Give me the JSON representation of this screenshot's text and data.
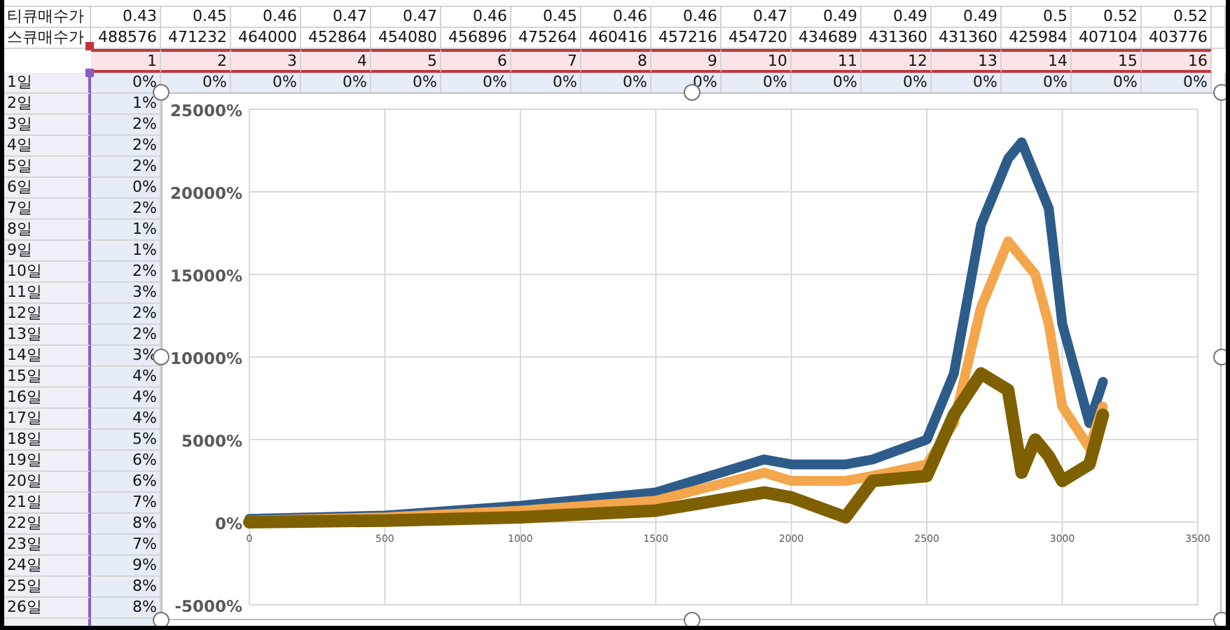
{
  "top_rows": [
    {
      "label": "티큐매수가",
      "cells": [
        "0.43",
        "0.45",
        "0.46",
        "0.47",
        "0.47",
        "0.46",
        "0.45",
        "0.46",
        "0.46",
        "0.47",
        "0.49",
        "0.49",
        "0.49",
        "0.5",
        "0.52",
        "0.52"
      ]
    },
    {
      "label": "스큐매수가",
      "cells": [
        "488576",
        "471232",
        "464000",
        "452864",
        "454080",
        "456896",
        "475264",
        "460416",
        "457216",
        "454720",
        "434689",
        "431360",
        "431360",
        "425984",
        "407104",
        "403776"
      ]
    }
  ],
  "header_numbers": [
    "1",
    "2",
    "3",
    "4",
    "5",
    "6",
    "7",
    "8",
    "9",
    "10",
    "11",
    "12",
    "13",
    "14",
    "15",
    "16"
  ],
  "first_day": {
    "label": "1일",
    "cells": [
      "0%",
      "0%",
      "0%",
      "0%",
      "0%",
      "0%",
      "0%",
      "0%",
      "0%",
      "0%",
      "0%",
      "0%",
      "0%",
      "0%",
      "0%",
      "0%"
    ]
  },
  "days": [
    {
      "label": "2일",
      "value": "1%"
    },
    {
      "label": "3일",
      "value": "2%"
    },
    {
      "label": "4일",
      "value": "2%"
    },
    {
      "label": "5일",
      "value": "2%"
    },
    {
      "label": "6일",
      "value": "0%"
    },
    {
      "label": "7일",
      "value": "2%"
    },
    {
      "label": "8일",
      "value": "1%"
    },
    {
      "label": "9일",
      "value": "1%"
    },
    {
      "label": "10일",
      "value": "2%"
    },
    {
      "label": "11일",
      "value": "3%"
    },
    {
      "label": "12일",
      "value": "2%"
    },
    {
      "label": "13일",
      "value": "2%"
    },
    {
      "label": "14일",
      "value": "3%"
    },
    {
      "label": "15일",
      "value": "4%"
    },
    {
      "label": "16일",
      "value": "4%"
    },
    {
      "label": "17일",
      "value": "4%"
    },
    {
      "label": "18일",
      "value": "5%"
    },
    {
      "label": "19일",
      "value": "6%"
    },
    {
      "label": "20일",
      "value": "6%"
    },
    {
      "label": "21일",
      "value": "7%"
    },
    {
      "label": "22일",
      "value": "8%"
    },
    {
      "label": "23일",
      "value": "7%"
    },
    {
      "label": "24일",
      "value": "9%"
    },
    {
      "label": "25일",
      "value": "8%"
    },
    {
      "label": "26일",
      "value": "8%"
    }
  ],
  "chart": {
    "chart_data": {
      "type": "line",
      "x": [
        0,
        500,
        1000,
        1500,
        1900,
        2000,
        2200,
        2300,
        2500,
        2600,
        2700,
        2800,
        2850,
        2900,
        2950,
        3000,
        3100,
        3150
      ],
      "series": [
        {
          "color": "#2e5c8a",
          "values": [
            200,
            400,
            1000,
            1800,
            3800,
            3500,
            3500,
            3800,
            5000,
            9000,
            18000,
            22000,
            23000,
            21000,
            19000,
            12000,
            6000,
            8500
          ]
        },
        {
          "color": "#f4a64c",
          "values": [
            100,
            300,
            700,
            1300,
            3000,
            2500,
            2500,
            2800,
            3500,
            6000,
            13000,
            17000,
            16000,
            15000,
            12000,
            7000,
            4500,
            7000
          ]
        },
        {
          "color": "#7f6000",
          "values": [
            0,
            100,
            300,
            700,
            1800,
            1500,
            300,
            2500,
            2800,
            6500,
            9000,
            8000,
            3000,
            5000,
            4000,
            2500,
            3500,
            6500
          ]
        }
      ],
      "grid": true,
      "xlim": [
        0,
        3500
      ],
      "ylim": [
        -5000,
        25000
      ],
      "xticks": [
        0,
        500,
        1000,
        1500,
        2000,
        2500,
        3000,
        3500
      ],
      "yticks": [
        {
          "value": 25000,
          "label": "25000%"
        },
        {
          "value": 20000,
          "label": "20000%"
        },
        {
          "value": 15000,
          "label": "15000%"
        },
        {
          "value": 10000,
          "label": "10000%"
        },
        {
          "value": 5000,
          "label": "5000%"
        },
        {
          "value": 0,
          "label": "0%"
        },
        {
          "value": -5000,
          "label": "-5000%"
        }
      ]
    }
  }
}
